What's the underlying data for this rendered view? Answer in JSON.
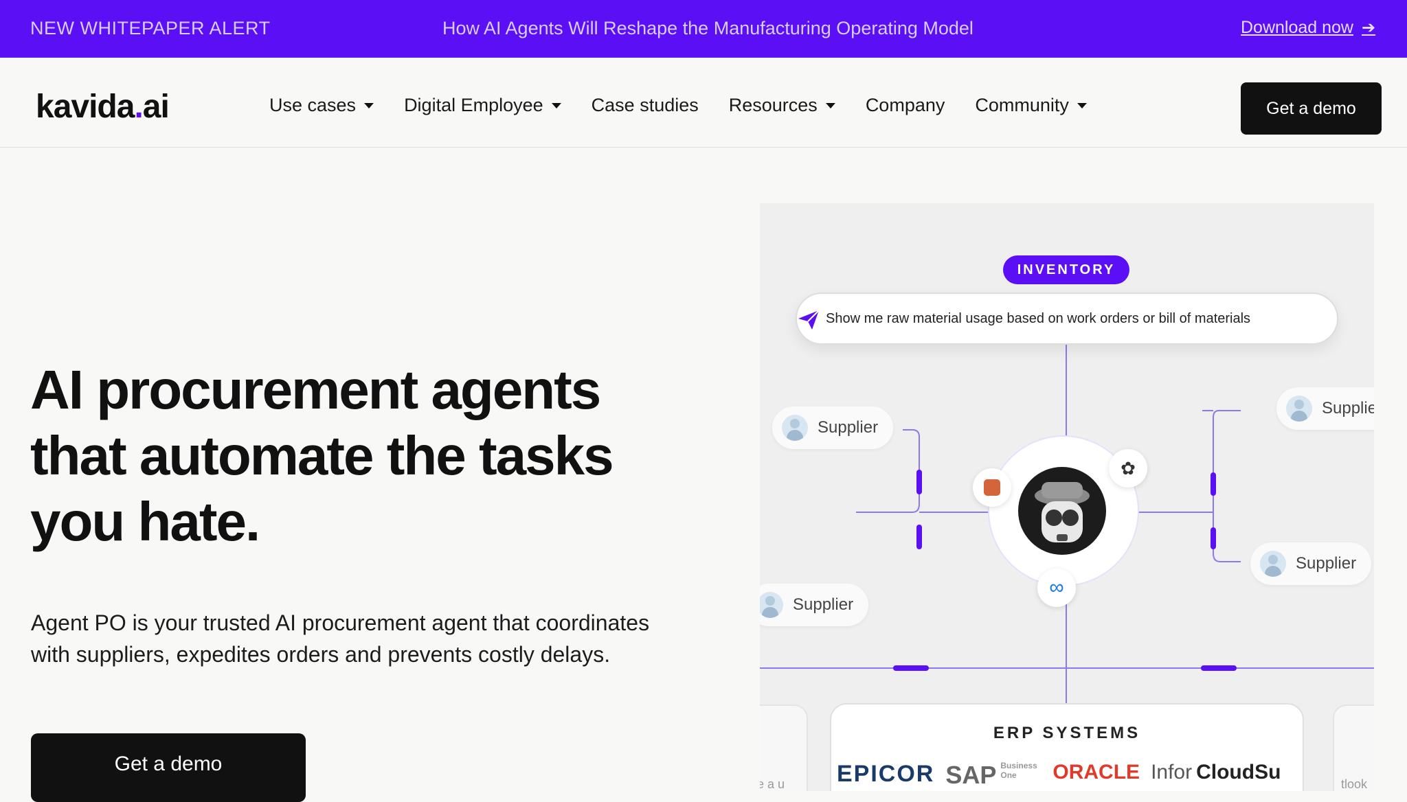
{
  "announcement": {
    "alert": "NEW WHITEPAPER ALERT",
    "headline": "How AI Agents Will Reshape the Manufacturing Operating Model",
    "link": "Download now"
  },
  "nav": {
    "logo_main": "kavida",
    "logo_dot": ".",
    "logo_tld": "ai",
    "items": [
      {
        "label": "Use cases",
        "dropdown": true
      },
      {
        "label": "Digital Employee",
        "dropdown": true
      },
      {
        "label": "Case studies",
        "dropdown": false
      },
      {
        "label": "Resources",
        "dropdown": true
      },
      {
        "label": "Company",
        "dropdown": false
      },
      {
        "label": "Community",
        "dropdown": true
      }
    ],
    "cta": "Get a demo"
  },
  "hero": {
    "title_lines": [
      "AI procurement agents",
      "that automate the tasks",
      "you hate."
    ],
    "subtitle_lines": [
      "Agent PO is your trusted AI procurement agent that coordinates",
      "with suppliers, expedites orders and prevents costly delays."
    ],
    "cta": "Get a demo"
  },
  "illustration": {
    "badge": "INVENTORY",
    "prompt": "Show me raw material usage based on work orders or bill of materials",
    "supplier_label": "Supplier",
    "erp_title": "ERP SYSTEMS",
    "erp_logos": [
      "EPICOR",
      "SAP",
      "Business One",
      "ORACLE",
      "Infor",
      "CloudSu"
    ],
    "side_left_text": "e a u",
    "side_right_text": "tlook",
    "accent": "#5a0ff5"
  }
}
